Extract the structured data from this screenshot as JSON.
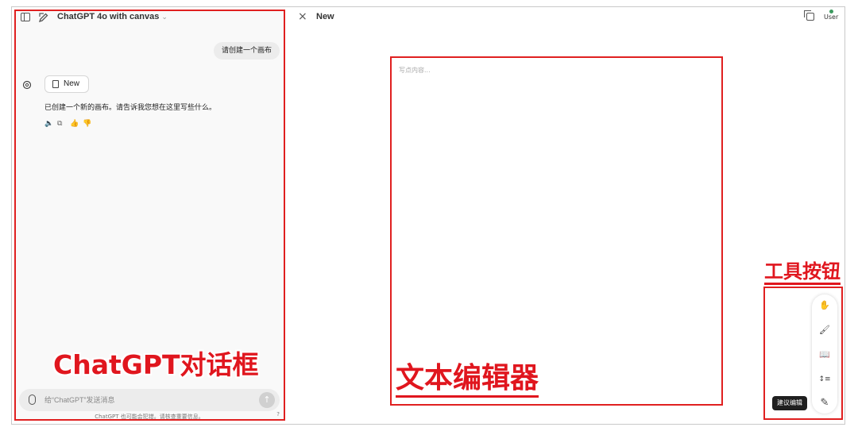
{
  "chat": {
    "model_title": "ChatGPT 4o with canvas",
    "user_message": "请创建一个画布",
    "canvas_chip_label": "New",
    "assistant_message": "已创建一个新的画布。请告诉我您想在这里写些什么。",
    "input_placeholder": "给“ChatGPT”发送消息",
    "footer_note": "ChatGPT 也可能会犯错。请核查重要信息。",
    "help_mark": "?"
  },
  "canvas": {
    "close_symbol": "×",
    "title": "New",
    "editor_placeholder": "写点内容...",
    "user_label": "User"
  },
  "toolbar": {
    "tools": [
      {
        "name": "hand-icon",
        "glyph": "✋"
      },
      {
        "name": "brush-icon",
        "glyph": "🖌"
      },
      {
        "name": "book-icon",
        "glyph": "📖"
      },
      {
        "name": "length-icon",
        "glyph": "↕≡"
      },
      {
        "name": "suggest-edit-icon",
        "glyph": "✎"
      }
    ],
    "tooltip": "建议编辑"
  },
  "annotations": {
    "chat_label": "ChatGPT对话框",
    "editor_label": "文本编辑器",
    "tools_label": "工具按钮"
  },
  "colors": {
    "annotation_red": "#e0161e",
    "panel_bg": "#f9f9f9",
    "tooltip_bg": "#1f1f1f"
  }
}
